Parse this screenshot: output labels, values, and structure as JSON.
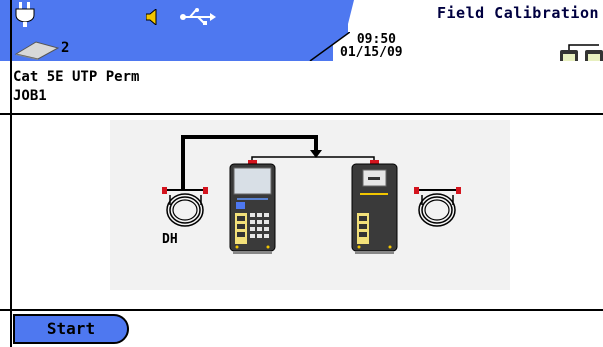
{
  "header": {
    "title": "Field Calibration",
    "time": "09:50",
    "date": "01/15/09",
    "badge_count": "2"
  },
  "job": {
    "test_limit": "Cat 5E UTP Perm",
    "job_name": "JOB1"
  },
  "diagram": {
    "label_dh": "DH"
  },
  "footer": {
    "start_label": "Start"
  },
  "colors": {
    "status_bar": "#4e78f0",
    "device_yellow": "#f2e07a",
    "connector_red": "#d4141e"
  },
  "icons": [
    "power-plug-icon",
    "speaker-icon",
    "usb-icon",
    "memory-card-icon",
    "tester-pair-icon",
    "cable-spool-icon",
    "main-unit-icon",
    "remote-unit-icon"
  ]
}
